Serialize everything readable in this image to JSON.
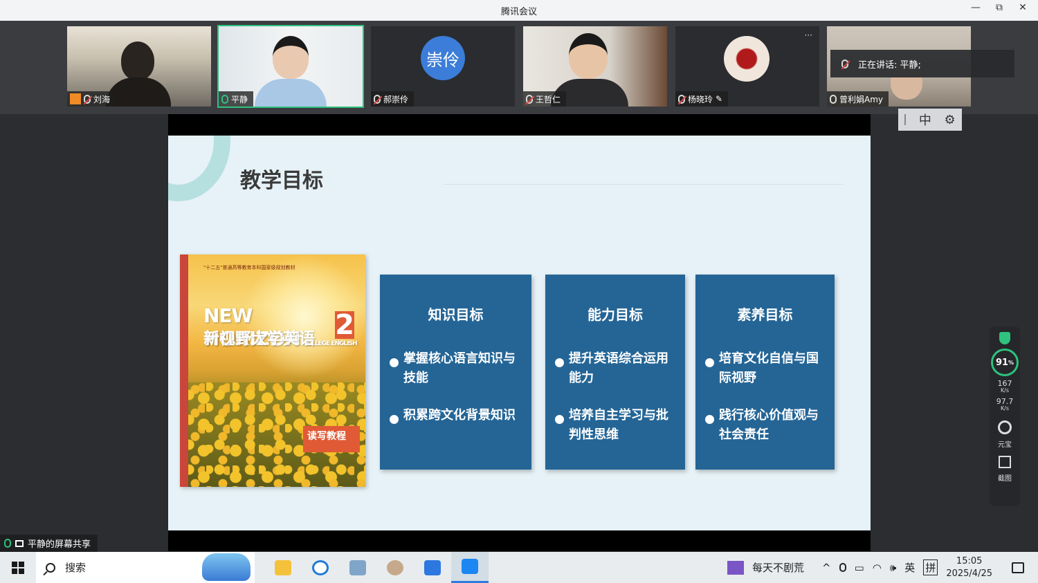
{
  "window": {
    "title": "腾讯会议",
    "buttons": [
      "—",
      "⧉",
      "✕"
    ]
  },
  "participants": [
    {
      "name": "刘海",
      "mic": "muted",
      "kind": "video"
    },
    {
      "name": "平静",
      "mic": "on",
      "kind": "video",
      "active": true
    },
    {
      "name": "郝崇伶",
      "mic": "muted",
      "kind": "avatar",
      "avatar_text": "崇伶"
    },
    {
      "name": "王哲仁",
      "mic": "muted",
      "kind": "video"
    },
    {
      "name": "杨晓玲",
      "mic": "muted",
      "kind": "photo",
      "more": "···"
    },
    {
      "name": "曾利娟Amy",
      "mic": "off",
      "kind": "video"
    }
  ],
  "speaking": {
    "label": "正在讲话:",
    "name": "平静;"
  },
  "lang_bar": {
    "lang": "中"
  },
  "slide": {
    "title": "教学目标",
    "book": {
      "top_line": "\"十二五\"普通高等教育本科国家级规划教材",
      "brand": "NEW HORIZON",
      "brand_sub": "COLLEGE ENGLISH",
      "title_cn": "新视野大学英语",
      "volume": "2",
      "badge": "读写教程"
    },
    "cards": [
      {
        "title": "知识目标",
        "items": [
          "掌握核心语言知识与技能",
          "积累跨文化背景知识"
        ]
      },
      {
        "title": "能力目标",
        "items": [
          "提升英语综合运用能力",
          "培养自主学习与批判性思维"
        ]
      },
      {
        "title": "素养目标",
        "items": [
          "培育文化自信与国际视野",
          "践行核心价值观与社会责任"
        ]
      }
    ]
  },
  "widget": {
    "percent": "91",
    "percent_unit": "%",
    "up": "167",
    "up_unit": "K/s",
    "down": "97.7",
    "down_unit": "K/s",
    "btn1": "元宝",
    "btn2": "截图"
  },
  "share_label": "平静的屏幕共享",
  "taskbar": {
    "search_label": "搜索",
    "tray_app": "每天不剧荒",
    "lang": "英",
    "ime": "拼",
    "time": "15:05",
    "date": "2025/4/25"
  }
}
